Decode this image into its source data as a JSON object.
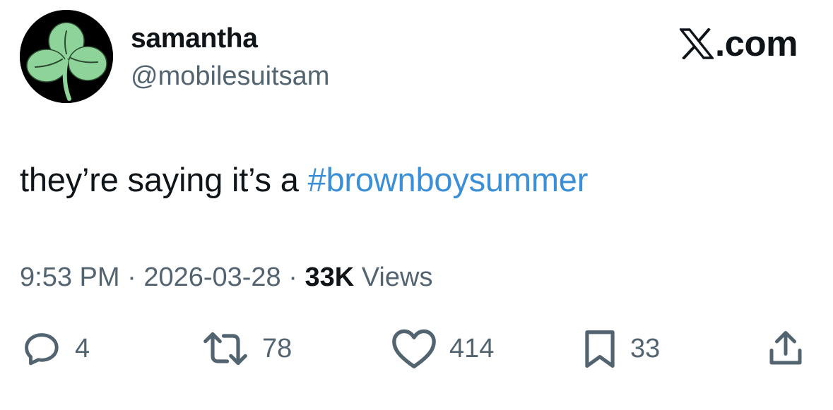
{
  "author": {
    "display_name": "samantha",
    "handle": "@mobilesuitsam",
    "avatar_icon": "shamrock-icon"
  },
  "site": {
    "logo_icon": "x-logo-icon",
    "label": ".com"
  },
  "tweet": {
    "text_plain": "they’re saying it’s a ",
    "hashtag": "#brownboysummer"
  },
  "meta": {
    "time": "9:53 PM",
    "sep1": " · ",
    "date": "2026-03-28",
    "sep2": " · ",
    "views_count": "33K",
    "views_label": " Views"
  },
  "actions": {
    "replies": "4",
    "reposts": "78",
    "likes": "414",
    "bookmarks": "33"
  },
  "colors": {
    "text": "#0f1419",
    "secondary": "#536471",
    "link": "#3b8fd6",
    "shamrock": "#8ed49a"
  }
}
